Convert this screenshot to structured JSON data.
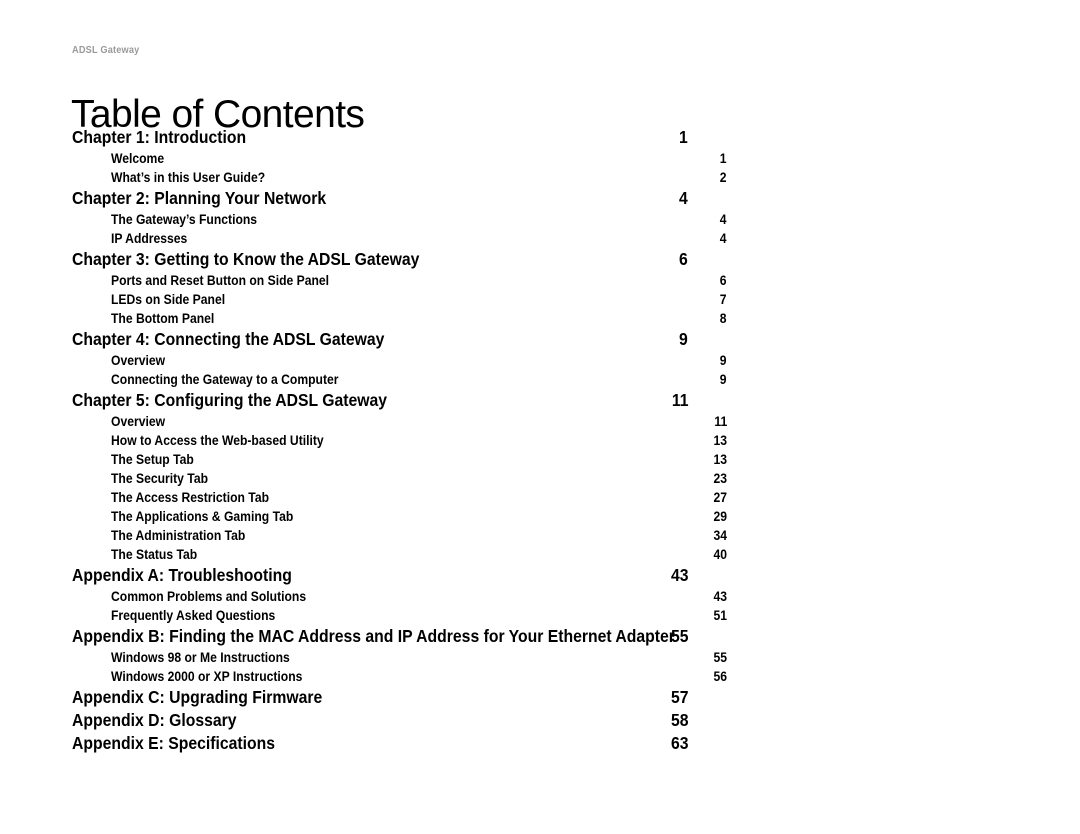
{
  "header": {
    "running_head": "ADSL Gateway",
    "running_head_color": "#9a9a9a",
    "title": "Table of Contents"
  },
  "toc": {
    "entries": [
      {
        "level": 1,
        "label": "Chapter 1: Introduction",
        "page": "1"
      },
      {
        "level": 2,
        "label": "Welcome",
        "page": "1"
      },
      {
        "level": 2,
        "label": "What’s in this User Guide?",
        "page": "2"
      },
      {
        "level": 1,
        "label": "Chapter 2: Planning Your Network",
        "page": "4"
      },
      {
        "level": 2,
        "label": "The Gateway’s Functions",
        "page": "4"
      },
      {
        "level": 2,
        "label": "IP Addresses",
        "page": "4"
      },
      {
        "level": 1,
        "label": "Chapter 3: Getting to Know the ADSL Gateway",
        "page": "6"
      },
      {
        "level": 2,
        "label": "Ports and Reset Button on Side Panel",
        "page": "6"
      },
      {
        "level": 2,
        "label": "LEDs on Side Panel",
        "page": "7"
      },
      {
        "level": 2,
        "label": "The Bottom Panel",
        "page": "8"
      },
      {
        "level": 1,
        "label": "Chapter 4: Connecting the ADSL Gateway",
        "page": "9"
      },
      {
        "level": 2,
        "label": "Overview",
        "page": "9"
      },
      {
        "level": 2,
        "label": "Connecting the Gateway to a Computer",
        "page": "9"
      },
      {
        "level": 1,
        "label": "Chapter 5: Configuring the ADSL Gateway",
        "page": "11"
      },
      {
        "level": 2,
        "label": "Overview",
        "page": "11"
      },
      {
        "level": 2,
        "label": "How to Access the Web-based Utility",
        "page": "13"
      },
      {
        "level": 2,
        "label": "The Setup Tab",
        "page": "13"
      },
      {
        "level": 2,
        "label": "The Security Tab",
        "page": "23"
      },
      {
        "level": 2,
        "label": "The Access Restriction Tab",
        "page": "27"
      },
      {
        "level": 2,
        "label": "The Applications & Gaming Tab",
        "page": "29"
      },
      {
        "level": 2,
        "label": "The Administration Tab",
        "page": "34"
      },
      {
        "level": 2,
        "label": "The Status Tab",
        "page": "40"
      },
      {
        "level": 1,
        "label": "Appendix A: Troubleshooting",
        "page": "43"
      },
      {
        "level": 2,
        "label": "Common Problems and Solutions",
        "page": "43"
      },
      {
        "level": 2,
        "label": "Frequently Asked Questions",
        "page": "51"
      },
      {
        "level": 1,
        "label": "Appendix B: Finding the MAC Address and IP Address for Your Ethernet Adapter",
        "page": "55"
      },
      {
        "level": 2,
        "label": "Windows 98 or Me Instructions",
        "page": "55"
      },
      {
        "level": 2,
        "label": "Windows 2000 or XP Instructions",
        "page": "56"
      },
      {
        "level": 1,
        "label": "Appendix C: Upgrading Firmware",
        "page": "57"
      },
      {
        "level": 1,
        "label": "Appendix D: Glossary",
        "page": "58"
      },
      {
        "level": 1,
        "label": "Appendix E: Specifications",
        "page": "63"
      }
    ]
  }
}
